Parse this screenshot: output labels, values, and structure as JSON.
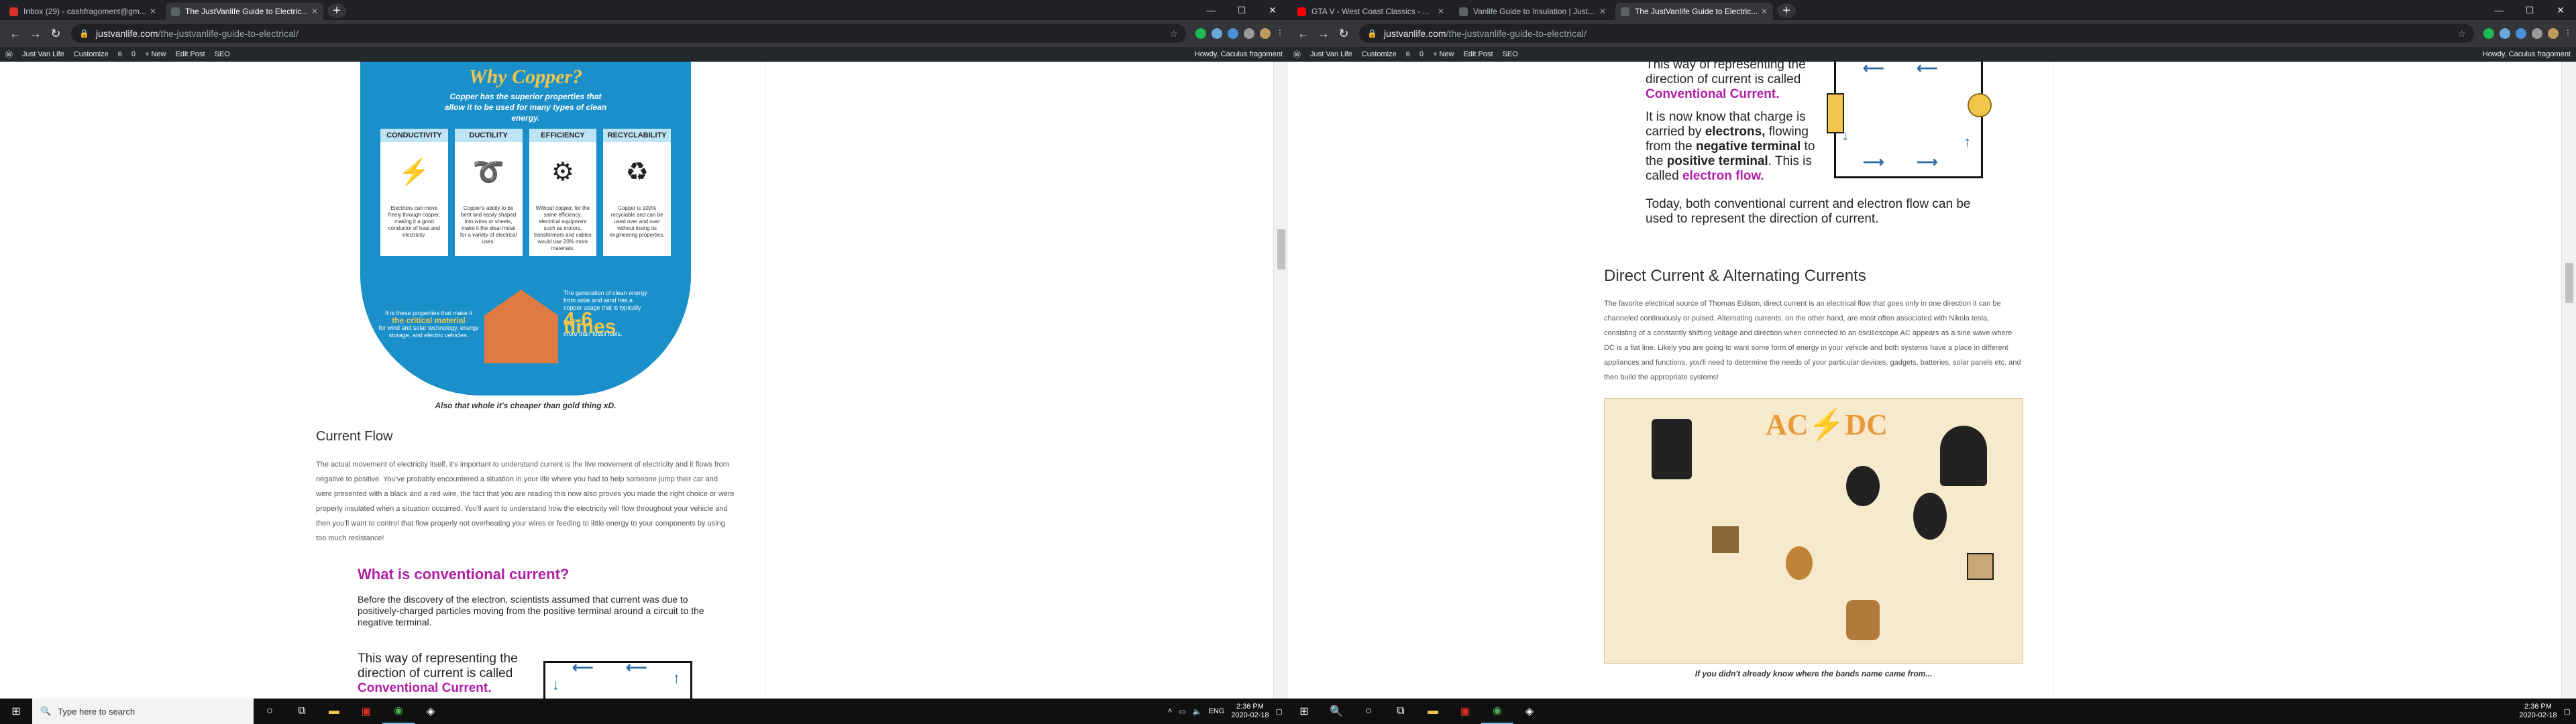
{
  "left": {
    "tabs": [
      {
        "title": "Inbox (29) - cashfragoment@gm...",
        "favicon": "#d93025"
      },
      {
        "title": "The JustVanlife Guide to Electric...",
        "favicon": "#5f6368"
      }
    ],
    "url_host": "justvanlife.com",
    "url_path": "/the-justvanlife-guide-to-electrical/",
    "wp_items": [
      "Just Van Life",
      "Customize",
      "6",
      "0",
      "+ New",
      "Edit Post",
      "SEO"
    ],
    "wp_howdy": "Howdy, Caculus fragoment",
    "info": {
      "title": "Why Copper?",
      "subtitle": "Copper has the superior properties that allow it to be used for many types of clean energy.",
      "cards": [
        {
          "head": "CONDUCTIVITY",
          "icon": "⚡",
          "text": "Electrons can move freely through copper, making it a good conductor of heat and electricity."
        },
        {
          "head": "DUCTILITY",
          "icon": "➰",
          "text": "Copper's ability to be bent and easily shaped into wires or sheets, make it the ideal metal for a variety of electrical uses."
        },
        {
          "head": "EFFICIENCY",
          "icon": "⚙",
          "text": "Without copper, for the same efficiency, electrical equipment such as motors, transformers and cables would use 20% more materials."
        },
        {
          "head": "RECYCLABILITY",
          "icon": "♻",
          "text": "Copper is 100% recyclable and can be used over and over without losing its engineering properties."
        }
      ],
      "low_left_pre": "It is these properties that make it",
      "low_left_bold": "the critical material",
      "low_left_post": "for wind and solar technology, energy storage, and electric vehicles.",
      "low_right_text": "The generation of clean energy from solar and wind has a copper usage that is typically",
      "low_right_big": "4-6 times",
      "low_right_post": "more than fossil fuels."
    },
    "caption": "Also that whole it's cheaper than gold thing xD.",
    "h_current": "Current Flow",
    "p_current": "The actual movement of electricity itself, it's important to understand current is the live movement of electricity and it flows from negative to positive. You've probably encountered a situation in your life where you had to help someone jump their car and were presented with a black and a red wire, the fact that you are reading this now also proves you made the right choice or were properly insulated when a situation occurred. You'll want to understand how the electricity will flow throughout your vehicle and then you'll want to control that flow properly not overheating your wires or feeding to little energy to your components by using too much resistance!",
    "h_conv": "What is conventional current?",
    "p_conv": "Before the discovery of the electron, scientists assumed that current was due to positively-charged particles moving from the positive terminal around a circuit to the negative terminal.",
    "p_way": "This way of representing the direction of current is called",
    "conv_term": "Conventional Current."
  },
  "right": {
    "tabs": [
      {
        "title": "GTA V - West Coast Classics - ...",
        "favicon": "#ff0000"
      },
      {
        "title": "Vanlife Guide to Insulation | Just...",
        "favicon": "#5f6368"
      },
      {
        "title": "The JustVanlife Guide to Electric...",
        "favicon": "#5f6368"
      }
    ],
    "url_host": "justvanlife.com",
    "url_path": "/the-justvanlife-guide-to-electrical/",
    "wp_items": [
      "Just Van Life",
      "Customize",
      "6",
      "0",
      "+ New",
      "Edit Post",
      "SEO"
    ],
    "wp_howdy": "Howdy, Caculus fragoment",
    "p_way": "This way of representing the direction of current is called",
    "conv_term": "Conventional Current.",
    "p_known_pre": "It is now know that charge is carried by",
    "electrons": "electrons,",
    "p_known_mid": "flowing from the",
    "neg": "negative terminal",
    "to_the": "to the",
    "pos": "positive terminal",
    "called": "This is called",
    "eflow": "electron flow.",
    "p_today": "Today, both conventional current and electron flow can be used to represent the direction of current.",
    "h_dcac": "Direct Current & Alternating Currents",
    "p_dcac": "The favorite electrical source of Thomas Edison, direct current is an electrical flow that goes only in one direction it can be channeled continuously or pulsed. Alternating currents, on the other hand, are most often associated with Nikola tesla, consisting of a constantly shifting voltage and direction when connected to an oscilloscope AC appears as a sine wave where DC is a flat line. Likely you are going to want some form of energy in your vehicle and both systems have a place in different appliances and functions, you'll need to determine the needs of your particular devices, gadgets, batteries, solar panels etc. and then build the appropriate systems!",
    "acdc_title_ac": "AC",
    "acdc_title_dc": "DC",
    "caption": "If you didn't already know where the bands name came from..."
  },
  "taskbar": {
    "search_placeholder": "Type here to search",
    "lang": "ENG",
    "time": "2:36 PM",
    "date": "2020-02-18"
  }
}
